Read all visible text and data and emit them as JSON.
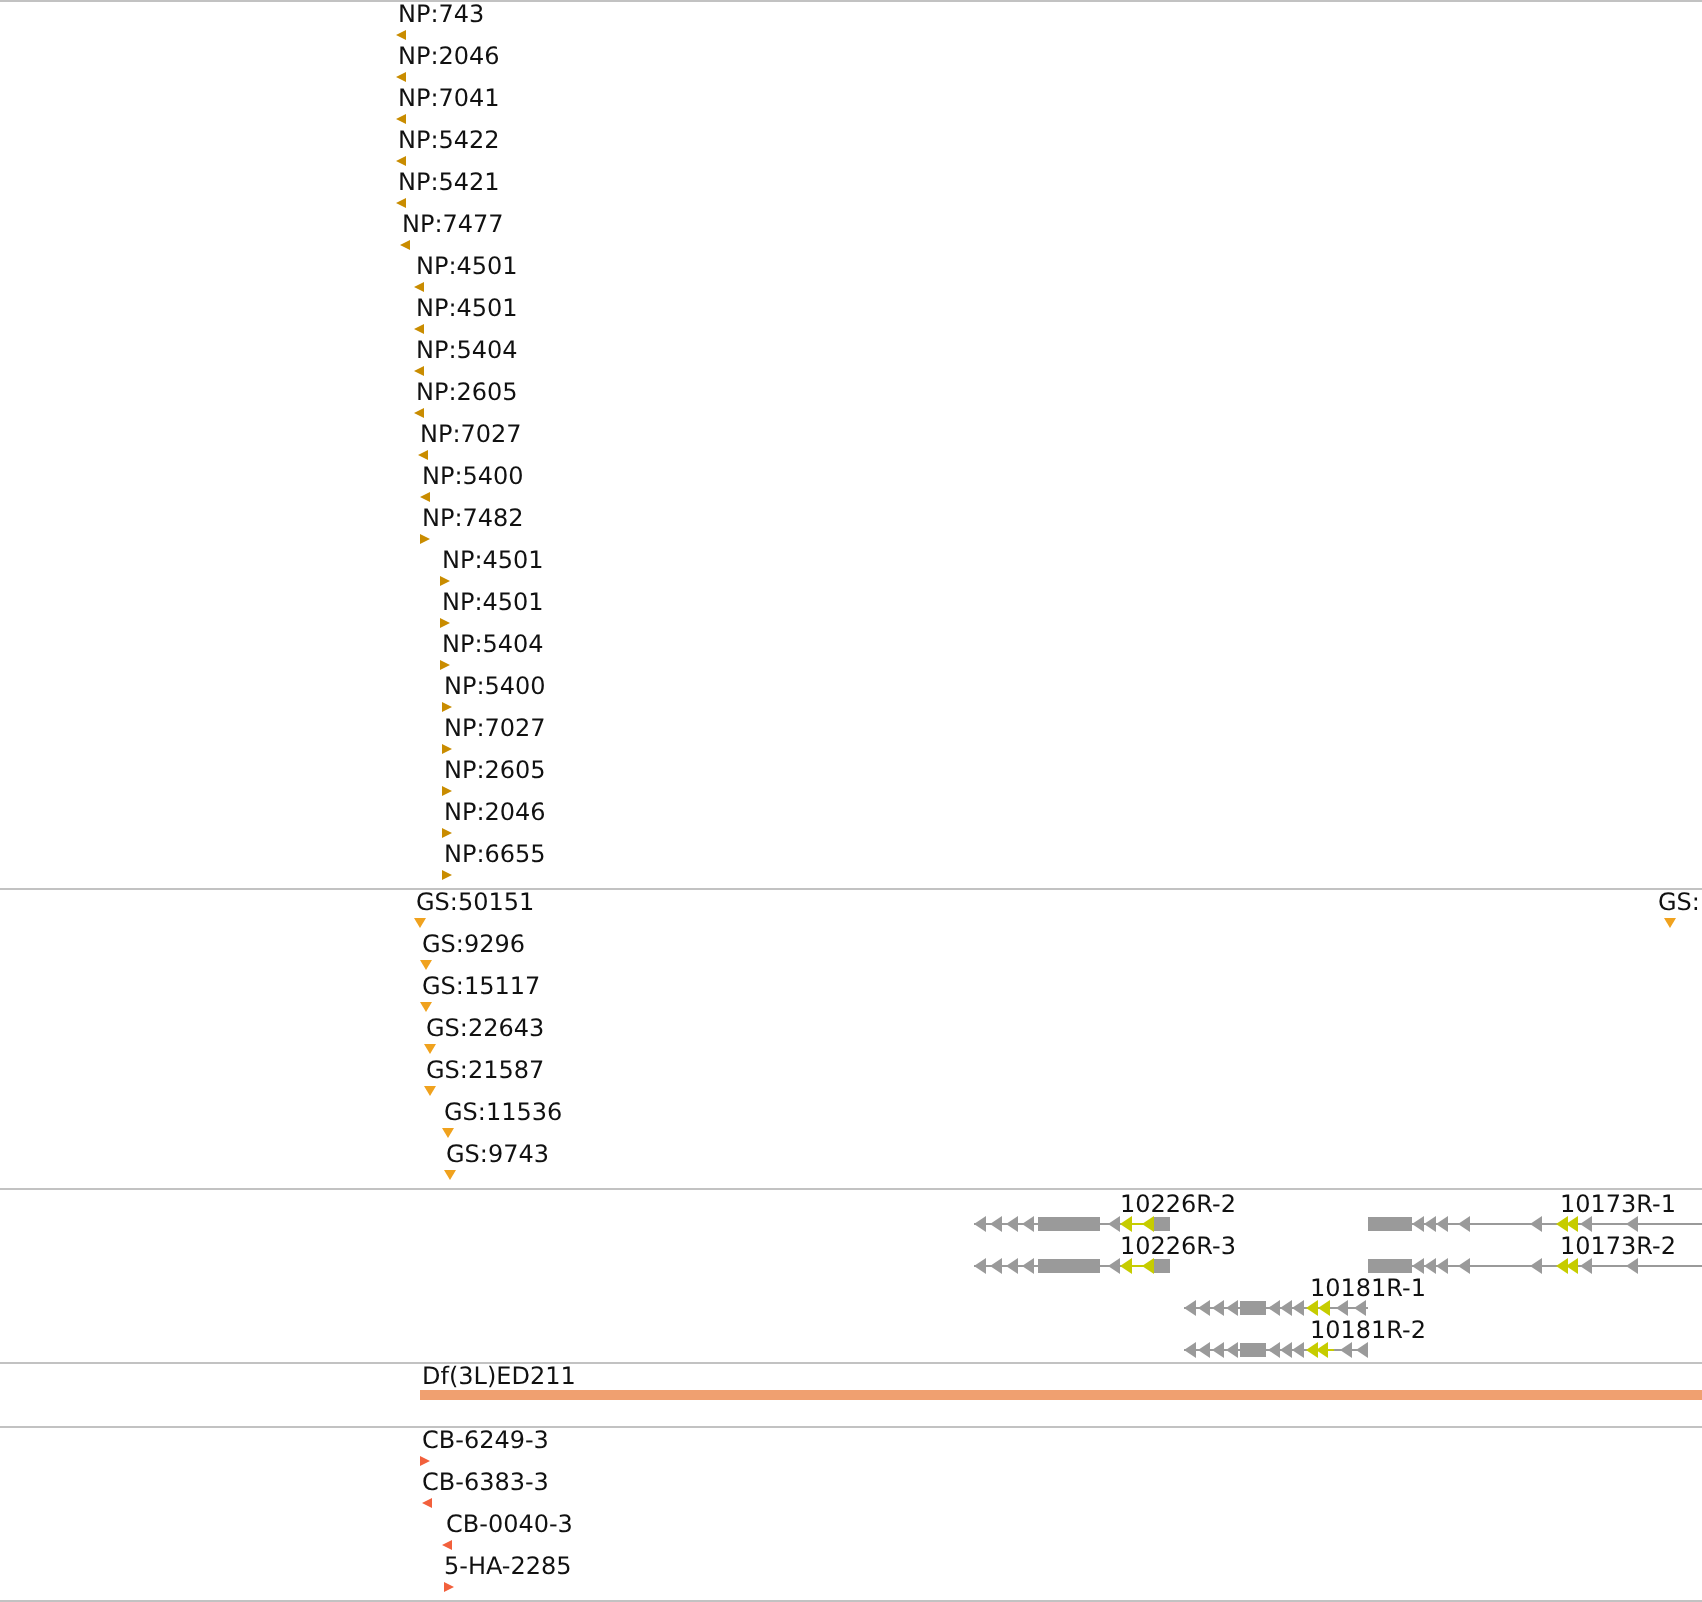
{
  "tracks": [
    {
      "kind": "points",
      "color": "#c98c00",
      "features": [
        {
          "label": "NP:743",
          "reverse": true
        },
        {
          "label": "NP:2046",
          "reverse": true
        },
        {
          "label": "NP:7041",
          "reverse": true
        },
        {
          "label": "NP:5422",
          "reverse": true
        },
        {
          "label": "NP:5421",
          "reverse": true
        },
        {
          "label": "NP:7477",
          "reverse": true
        },
        {
          "label": "NP:4501",
          "reverse": true
        },
        {
          "label": "NP:4501",
          "reverse": true
        },
        {
          "label": "NP:5404",
          "reverse": true
        },
        {
          "label": "NP:2605",
          "reverse": true
        },
        {
          "label": "NP:7027",
          "reverse": true
        },
        {
          "label": "NP:5400",
          "reverse": true
        },
        {
          "label": "NP:7482",
          "reverse": false
        },
        {
          "label": "NP:4501",
          "reverse": false
        },
        {
          "label": "NP:4501",
          "reverse": false
        },
        {
          "label": "NP:5404",
          "reverse": false
        },
        {
          "label": "NP:5400",
          "reverse": false
        },
        {
          "label": "NP:7027",
          "reverse": false
        },
        {
          "label": "NP:2605",
          "reverse": false
        },
        {
          "label": "NP:2046",
          "reverse": false
        },
        {
          "label": "NP:6655",
          "reverse": false
        }
      ]
    },
    {
      "kind": "points",
      "color": "#f0a21e",
      "features": [
        {
          "label": "GS:50151"
        },
        {
          "label": "GS:"
        },
        {
          "label": "GS:9296"
        },
        {
          "label": "GS:15117"
        },
        {
          "label": "GS:22643"
        },
        {
          "label": "GS:21587"
        },
        {
          "label": "GS:11536"
        },
        {
          "label": "GS:9743"
        }
      ]
    },
    {
      "kind": "transcripts",
      "features": [
        {
          "label": "10226R-2"
        },
        {
          "label": "10173R-1"
        },
        {
          "label": "10226R-3"
        },
        {
          "label": "10173R-2"
        },
        {
          "label": "10181R-1"
        },
        {
          "label": "10181R-2"
        }
      ]
    },
    {
      "kind": "range",
      "color": "#f0a070",
      "features": [
        {
          "label": "Df(3L)ED211"
        }
      ]
    },
    {
      "kind": "points",
      "color": "#f2603c",
      "features": [
        {
          "label": "CB-6249-3",
          "reverse": false
        },
        {
          "label": "CB-6383-3",
          "reverse": true
        },
        {
          "label": "CB-0040-3",
          "reverse": true
        },
        {
          "label": "5-HA-2285",
          "reverse": false
        }
      ]
    }
  ]
}
